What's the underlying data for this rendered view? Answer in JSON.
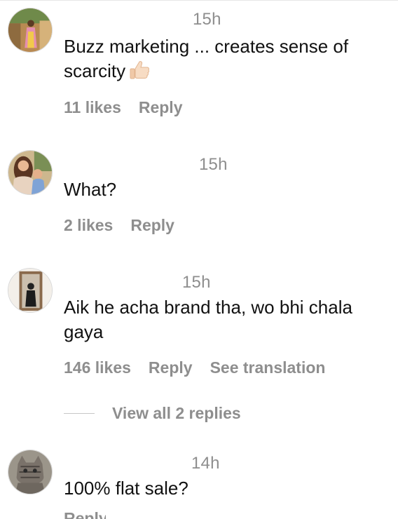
{
  "comments": [
    {
      "time": "15h",
      "text": "Buzz marketing ... creates sense of scarcity",
      "emoji": "thumbs-up-icon",
      "likes": "11 likes",
      "reply": "Reply"
    },
    {
      "time": "15h",
      "text": "What?",
      "likes": "2 likes",
      "reply": "Reply"
    },
    {
      "time": "15h",
      "text": "Aik he acha brand tha, wo bhi chala gaya",
      "likes": "146 likes",
      "reply": "Reply",
      "translate": "See translation",
      "view_replies": "View all 2 replies"
    },
    {
      "time": "14h",
      "text": "100% flat sale?",
      "reply": "Reply"
    }
  ],
  "colors": {
    "text": "#111111",
    "muted": "#8e8e8e",
    "divider": "#c7c7c7"
  }
}
